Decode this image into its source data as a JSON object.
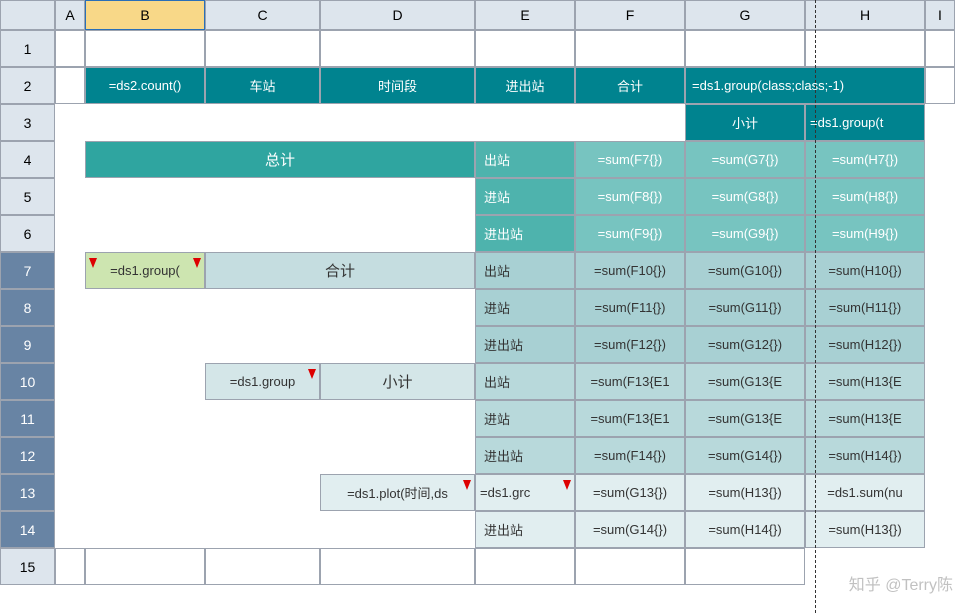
{
  "columns": [
    "",
    "A",
    "B",
    "C",
    "D",
    "E",
    "F",
    "G",
    "H",
    "I"
  ],
  "selected_column": "B",
  "rows": [
    "1",
    "2",
    "3",
    "4",
    "5",
    "6",
    "7",
    "8",
    "9",
    "10",
    "11",
    "12",
    "13",
    "14",
    "15"
  ],
  "dark_rows": [
    "7",
    "8",
    "9",
    "10",
    "11",
    "12",
    "13",
    "14"
  ],
  "hdr": {
    "b23": "=ds2.count()",
    "c23": "车站",
    "d23": "时间段",
    "e23": "进出站",
    "f23": "合计",
    "g2": "=ds1.group(class;class;-1)",
    "g3": "小计",
    "h3": "=ds1.group(t"
  },
  "totals": {
    "label": "总计",
    "r4": {
      "e": "出站",
      "f": "=sum(F7{})",
      "g": "=sum(G7{})",
      "h": "=sum(H7{})"
    },
    "r5": {
      "e": "进站",
      "f": "=sum(F8{})",
      "g": "=sum(G8{})",
      "h": "=sum(H8{})"
    },
    "r6": {
      "e": "进出站",
      "f": "=sum(F9{})",
      "g": "=sum(G9{})",
      "h": "=sum(H9{})"
    }
  },
  "body": {
    "b": "=ds1.group(",
    "c": "=ds1.group",
    "heji": "合计",
    "xiaoji": "小计",
    "d1314": "=ds1.plot(时间,ds",
    "r7": {
      "e": "出站",
      "f": "=sum(F10{})",
      "g": "=sum(G10{})",
      "h": "=sum(H10{})"
    },
    "r8": {
      "e": "进站",
      "f": "=sum(F11{})",
      "g": "=sum(G11{})",
      "h": "=sum(H11{})"
    },
    "r9": {
      "e": "进出站",
      "f": "=sum(F12{})",
      "g": "=sum(G12{})",
      "h": "=sum(H12{})"
    },
    "r10": {
      "e": "出站",
      "f": "=sum(F13{E1",
      "g": "=sum(G13{E",
      "h": "=sum(H13{E"
    },
    "r11": {
      "e": "进站",
      "f": "=sum(F13{E1",
      "g": "=sum(G13{E",
      "h": "=sum(H13{E"
    },
    "r12": {
      "e": "进出站",
      "f": "=sum(F14{})",
      "g": "=sum(G14{})",
      "h": "=sum(H14{})"
    },
    "r13": {
      "e": "=ds1.grc",
      "f": "=sum(G13{})",
      "g": "=sum(H13{})",
      "h": "=ds1.sum(nu"
    },
    "r14": {
      "e": "进出站",
      "f": "=sum(G14{})",
      "g": "=sum(H14{})",
      "h": "=sum(H13{})"
    }
  },
  "watermark": "知乎 @Terry陈"
}
